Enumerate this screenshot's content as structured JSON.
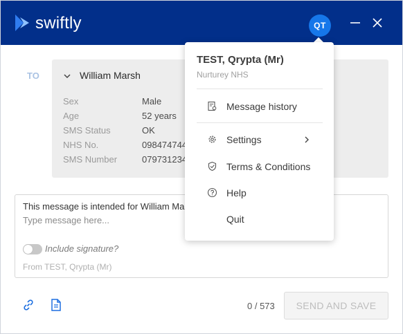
{
  "app": {
    "brand": "swiftly",
    "avatar_initials": "QT",
    "accent_color": "#022f8a",
    "avatar_color": "#1677ea"
  },
  "recipient": {
    "to_label": "TO",
    "name": "William Marsh",
    "details": [
      {
        "key": "Sex",
        "value": "Male"
      },
      {
        "key": "Age",
        "value": "52 years"
      },
      {
        "key": "SMS Status",
        "value": "OK"
      },
      {
        "key": "NHS No.",
        "value": "0984747440"
      },
      {
        "key": "SMS Number",
        "value": "0797312345"
      }
    ]
  },
  "composer": {
    "intro_text": "This message is intended for William Marsh",
    "placeholder": "Type message here...",
    "signature_label": "Include signature?",
    "signature_enabled": false,
    "from_text": "From TEST, Qrypta (Mr)"
  },
  "footer": {
    "icons": [
      "link-icon",
      "document-icon"
    ],
    "char_count": "0 / 573",
    "send_label": "SEND AND SAVE"
  },
  "menu": {
    "user_name": "TEST, Qrypta (Mr)",
    "organisation": "Nurturey NHS",
    "items": [
      {
        "label": "Message history",
        "icon": "history-icon"
      },
      {
        "label": "Settings",
        "icon": "gear-icon",
        "has_submenu": true
      },
      {
        "label": "Terms & Conditions",
        "icon": "shield-check-icon"
      },
      {
        "label": "Help",
        "icon": "help-icon"
      },
      {
        "label": "Quit",
        "icon": ""
      }
    ]
  }
}
